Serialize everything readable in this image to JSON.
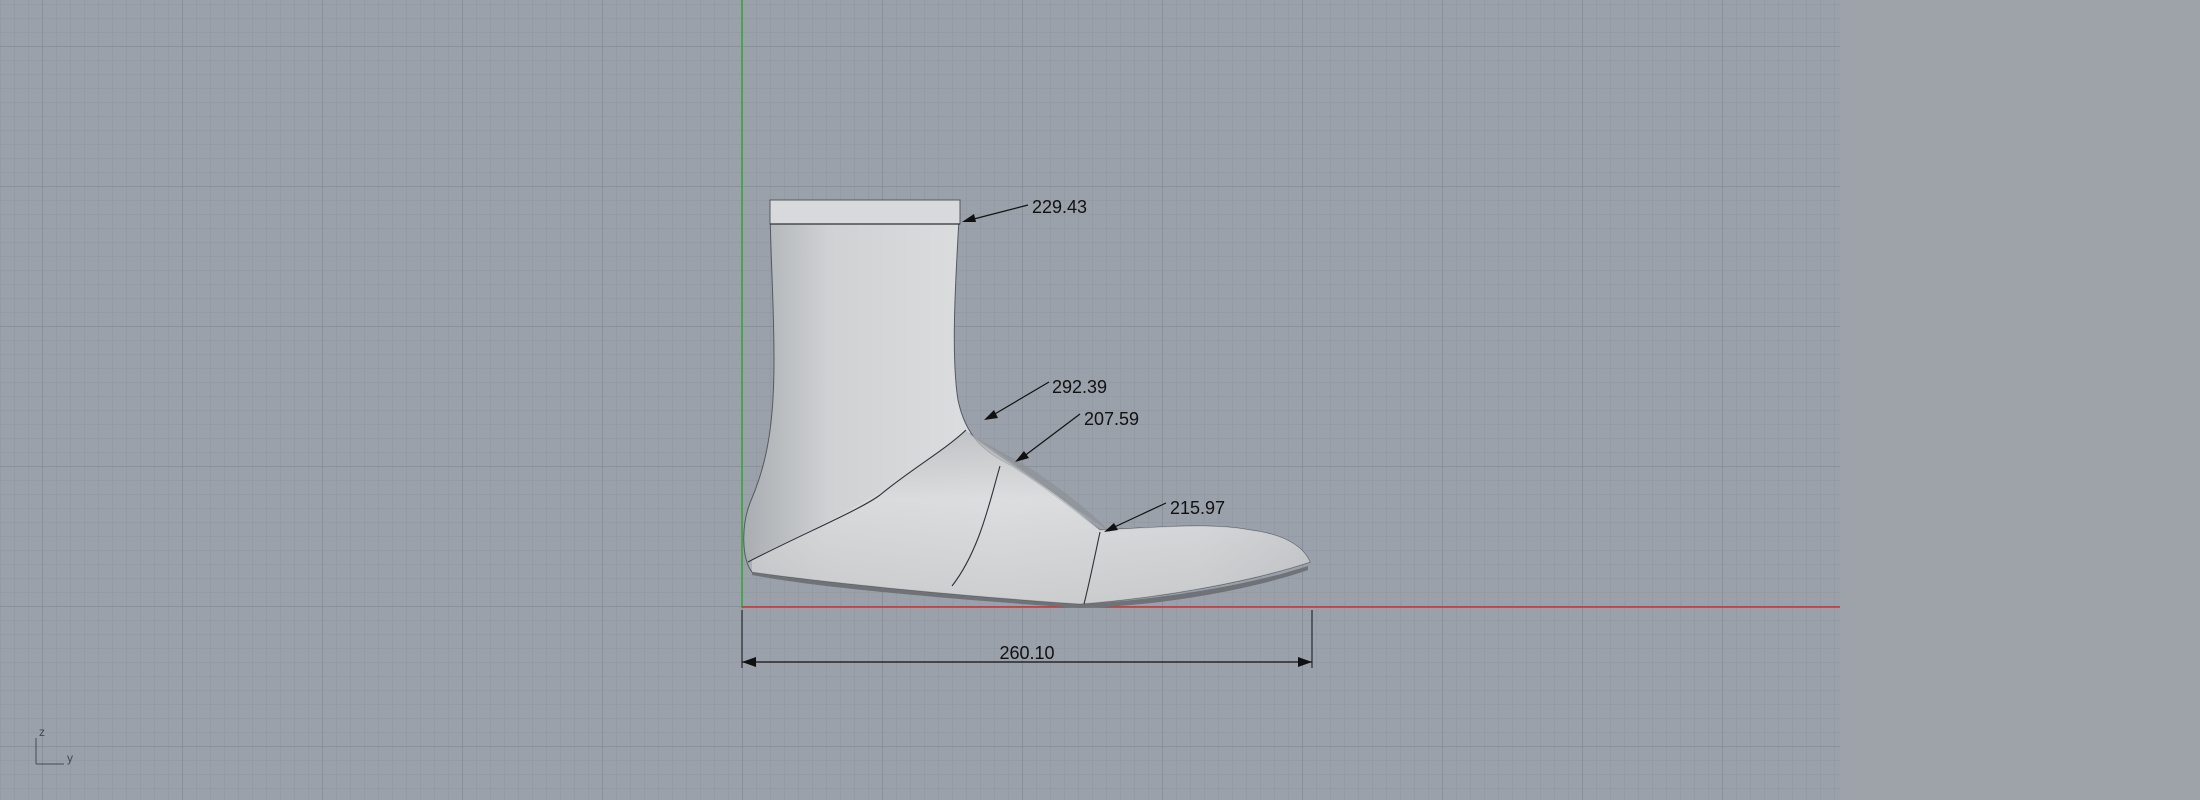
{
  "viewport": {
    "background": "#9aa1aa",
    "grid_minor_color": "#8e959e",
    "grid_major_color": "#7f8791",
    "x_axis_color": "#cc3333",
    "y_axis_color": "#33aa33"
  },
  "side_panel": {
    "background": "#9ea3aa"
  },
  "dimensions": {
    "top_opening": "229.43",
    "instep_high": "292.39",
    "instep_low": "207.59",
    "ball": "215.97",
    "length": "260.10"
  },
  "axis_widget": {
    "vertical_label": "z",
    "horizontal_label": "y"
  }
}
